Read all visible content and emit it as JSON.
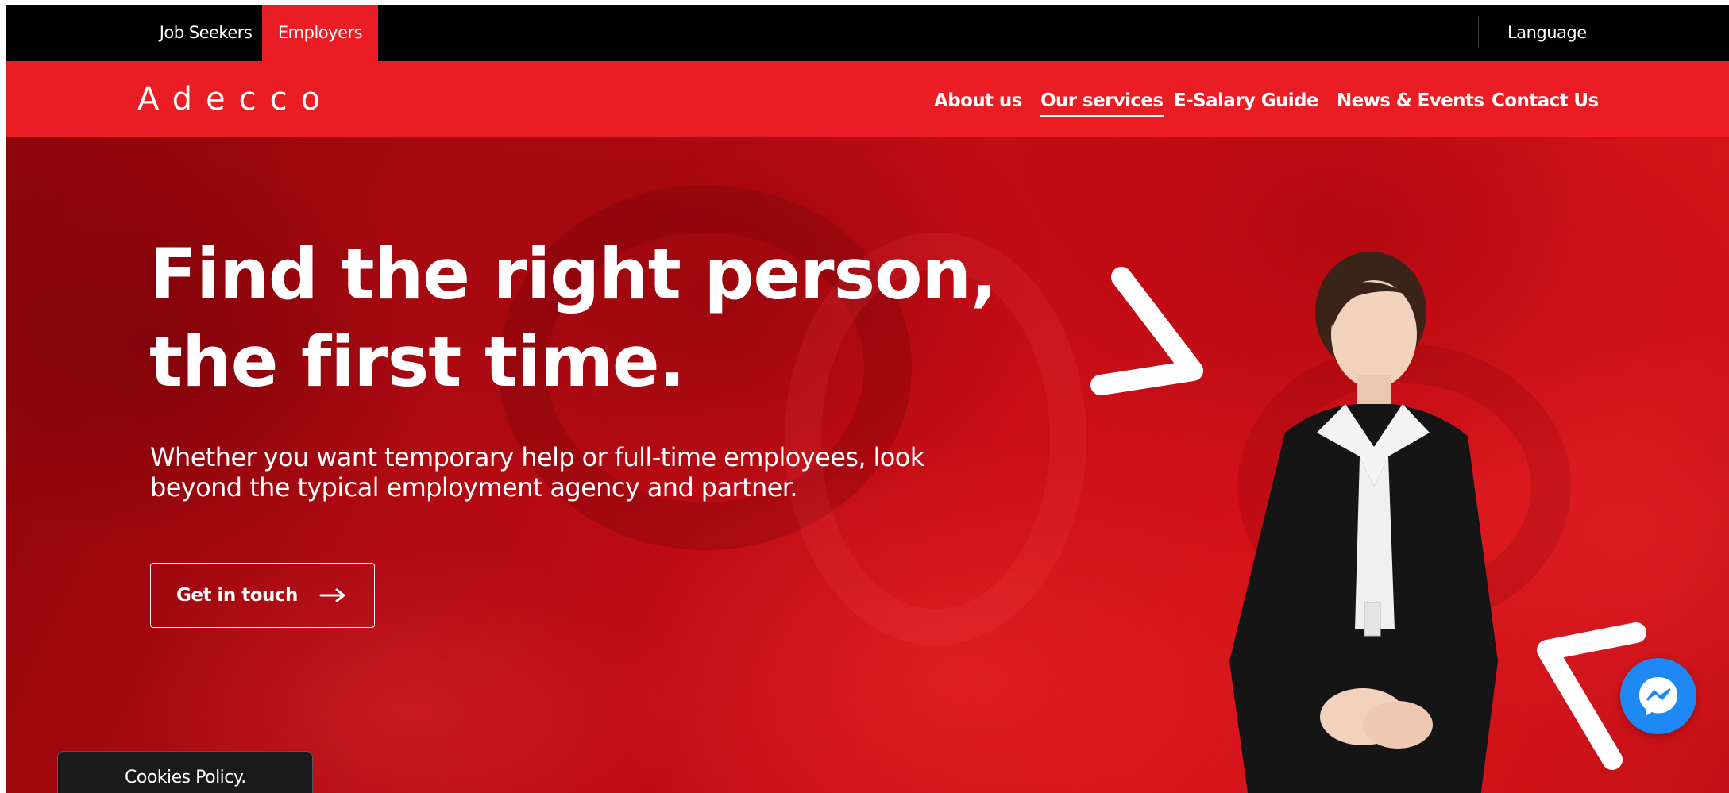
{
  "topbar": {
    "tabs": [
      {
        "label": "Job Seekers",
        "active": false
      },
      {
        "label": "Employers",
        "active": true
      }
    ],
    "language_label": "Language"
  },
  "navbar": {
    "logo_text": "Adecco",
    "items": [
      {
        "label": "About us",
        "active": false
      },
      {
        "label": "Our services",
        "active": true
      },
      {
        "label": "E-Salary Guide",
        "active": false
      },
      {
        "label": "News & Events",
        "active": false
      },
      {
        "label": "Contact Us",
        "active": false
      }
    ]
  },
  "hero": {
    "headline_line1": "Find the right person,",
    "headline_line2": "the first time.",
    "subtext_line1": "Whether you want temporary help or full-time employees, look",
    "subtext_line2": "beyond the typical employment agency and partner.",
    "cta_label": "Get in touch",
    "cta_icon": "arrow-right-icon"
  },
  "widgets": {
    "messenger_icon": "messenger-icon",
    "cookies_label": "Cookies Policy."
  },
  "colors": {
    "brand_red": "#ea1d25",
    "topbar_black": "#000000",
    "messenger_blue": "#1e88f5"
  }
}
